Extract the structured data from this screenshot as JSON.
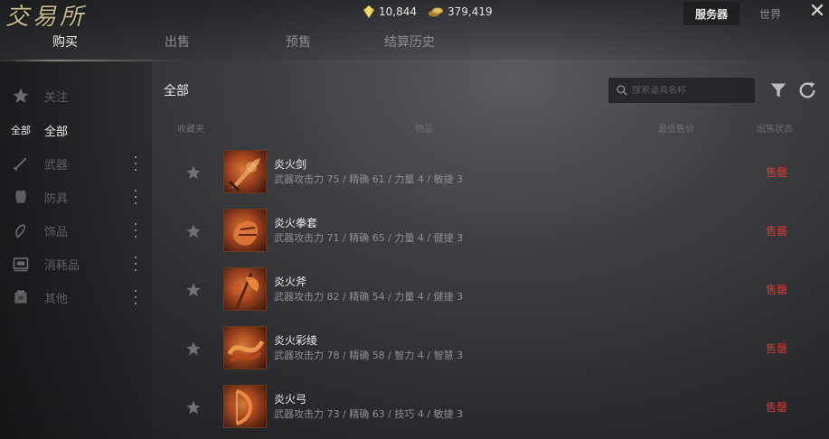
{
  "header": {
    "logo_text": "交易所",
    "gem_amount": "10,844",
    "gold_amount": "379,419",
    "server_label": "服务器",
    "second_button_label": "世界",
    "close_symbol": "✕"
  },
  "tabs": [
    {
      "label": "购买",
      "active": true
    },
    {
      "label": "出售",
      "active": false
    },
    {
      "label": "预售",
      "active": false
    },
    {
      "label": "结算历史",
      "active": false
    }
  ],
  "sidebar": {
    "items": [
      {
        "icon": "star-icon",
        "label": "关注",
        "active": false
      },
      {
        "tag": "全部",
        "label": "全部",
        "active": true
      },
      {
        "icon": "weapon-icon",
        "label": "武器",
        "active": false,
        "has_more": true
      },
      {
        "icon": "armor-icon",
        "label": "防具",
        "active": false,
        "has_more": true
      },
      {
        "icon": "accessory-icon",
        "label": "饰品",
        "active": false,
        "has_more": true
      },
      {
        "icon": "consumable-icon",
        "label": "消耗品",
        "active": false,
        "has_more": true
      },
      {
        "icon": "material-icon",
        "label": "其他",
        "active": false,
        "has_more": true
      }
    ]
  },
  "main": {
    "category_title": "全部",
    "search_placeholder": "搜索道具名称",
    "columns": {
      "favorite": "收藏夹",
      "attributes": "物品",
      "price": "最低售价",
      "status": "出售状态"
    },
    "rows": [
      {
        "name": "炎火剑",
        "attrs": "武器攻击力 75  / 精确 61  / 力量 4  / 敏捷 3",
        "status": "售罄"
      },
      {
        "name": "炎火拳套",
        "attrs": "武器攻击力 71  / 精确 65  / 力量 4  / 健捷 3",
        "status": "售罄"
      },
      {
        "name": "炎火斧",
        "attrs": "武器攻击力 82  / 精确 54  / 力量 4  / 健捷 3",
        "status": "售罄"
      },
      {
        "name": "炎火彩绫",
        "attrs": "武器攻击力 78  / 精确 58  / 智力 4  / 智慧 3",
        "status": "售罄"
      },
      {
        "name": "炎火弓",
        "attrs": "武器攻击力 73  / 精确 63  / 技巧 4  / 敏捷 3",
        "status": "售罄"
      }
    ]
  },
  "colors": {
    "status_red": "#d23a34",
    "gold": "#c9a23a",
    "gem": "#e6c64a"
  }
}
